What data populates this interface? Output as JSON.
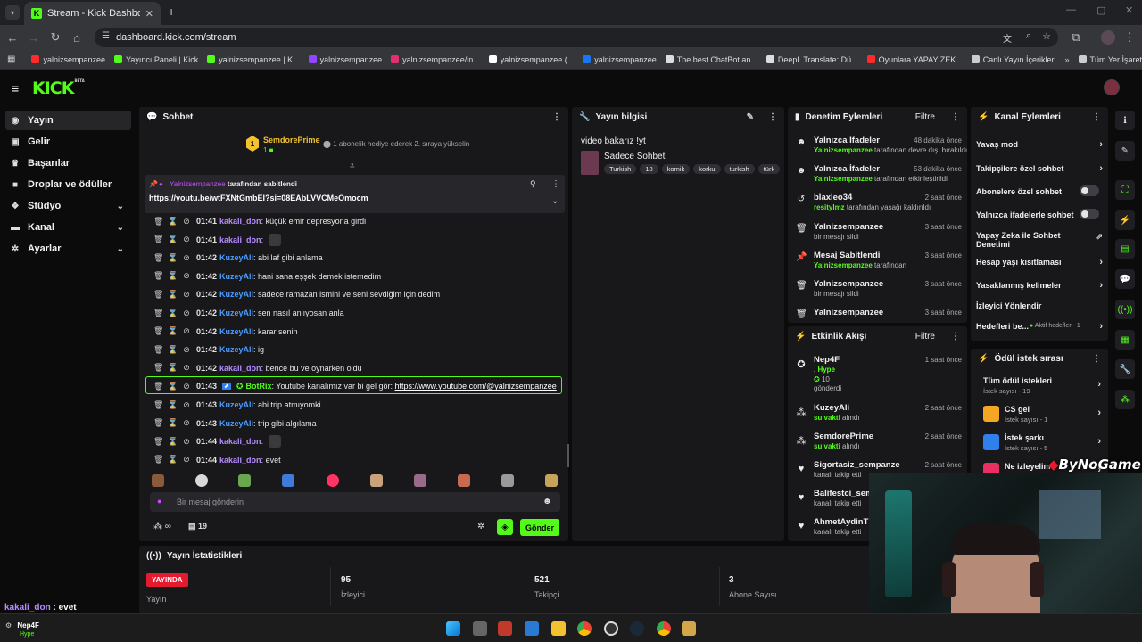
{
  "browser": {
    "tab_title": "Stream - Kick Dashboard",
    "url": "dashboard.kick.com/stream",
    "bookmarks": [
      {
        "label": "yalnizsempanzee",
        "color": "#ff2b2b"
      },
      {
        "label": "Yayıncı Paneli | Kick",
        "color": "#53fc18"
      },
      {
        "label": "yalnizsempanzee | K...",
        "color": "#53fc18"
      },
      {
        "label": "yalnizsempanzee",
        "color": "#9146ff"
      },
      {
        "label": "yalnizsempanzee/in...",
        "color": "#e1306c"
      },
      {
        "label": "yalnizsempanzee (...",
        "color": "#ffffff"
      },
      {
        "label": "yalnizsempanzee",
        "color": "#1877f2"
      },
      {
        "label": "The best ChatBot an...",
        "color": "#dddddd"
      },
      {
        "label": "DeepL Translate: Dü...",
        "color": "#dddddd"
      },
      {
        "label": "Oyunlara YAPAY ZEK...",
        "color": "#ff2b2b"
      },
      {
        "label": "Canlı Yayın İçerikleri",
        "color": "#cccccc"
      }
    ],
    "bookmarks_all": "Tüm Yer İşaretleri"
  },
  "kick": {
    "logo": "KICK",
    "beta": "BETA"
  },
  "sidebar": {
    "items": [
      {
        "label": "Yayın",
        "icon": "broadcast-icon"
      },
      {
        "label": "Gelir",
        "icon": "revenue-icon"
      },
      {
        "label": "Başarılar",
        "icon": "trophy-icon"
      },
      {
        "label": "Droplar ve ödüller",
        "icon": "gift-icon"
      },
      {
        "label": "Stüdyo",
        "icon": "studio-icon"
      },
      {
        "label": "Kanal",
        "icon": "channel-icon"
      },
      {
        "label": "Ayarlar",
        "icon": "gear-icon"
      }
    ]
  },
  "chat": {
    "title": "Sohbet",
    "top_gifter": "SemdorePrime",
    "top_gifter_count": "1",
    "gift_note": "1 abonelik hediye ederek 2. sıraya yükselin",
    "pinned_by_user": "Yalnizsempanzee",
    "pinned_by_suffix": "tarafından sabitlendi",
    "pinned_link": "https://youtu.be/wtFXNtGmbEI?si=08EAbLVVCMeOmocm",
    "messages": [
      {
        "time": "01:41",
        "user": "kakali_don",
        "cls": "u-p",
        "text": ": küçük emir depresyona girdi"
      },
      {
        "time": "01:41",
        "user": "kakali_don",
        "cls": "u-p",
        "text": ":"
      },
      {
        "time": "01:42",
        "user": "KuzeyAli",
        "cls": "u-b",
        "text": ": abi laf gibi anlama"
      },
      {
        "time": "01:42",
        "user": "KuzeyAli",
        "cls": "u-b",
        "text": ": hani sana eşşek demek istemedim"
      },
      {
        "time": "01:42",
        "user": "KuzeyAli",
        "cls": "u-b",
        "text": ": sadece ramazan ismini ve seni sevdiğim için dedim"
      },
      {
        "time": "01:42",
        "user": "KuzeyAli",
        "cls": "u-b",
        "text": ": sen nasıl anlıyosan anla"
      },
      {
        "time": "01:42",
        "user": "KuzeyAli",
        "cls": "u-b",
        "text": ": karar senin"
      },
      {
        "time": "01:42",
        "user": "KuzeyAli",
        "cls": "u-b",
        "text": ": ig"
      },
      {
        "time": "01:42",
        "user": "kakali_don",
        "cls": "u-p",
        "text": ": bence bu ve oynarken oldu"
      },
      {
        "time": "01:43",
        "user": "BotRix",
        "cls": "u-g",
        "text": ": Youtube kanalımız var bi gel gör: ",
        "link": "https://www.youtube.com/@yalnizsempanzee"
      },
      {
        "time": "01:43",
        "user": "KuzeyAli",
        "cls": "u-b",
        "text": ": abi trip atmıyomki"
      },
      {
        "time": "01:43",
        "user": "KuzeyAli",
        "cls": "u-b",
        "text": ": trip gibi algılama"
      },
      {
        "time": "01:44",
        "user": "kakali_don",
        "cls": "u-p",
        "text": ":"
      },
      {
        "time": "01:44",
        "user": "kakali_don",
        "cls": "u-p",
        "text": ": evet"
      }
    ],
    "input_placeholder": "Bir mesaj gönderin",
    "viewer_count": "19",
    "send_label": "Gönder"
  },
  "stream_info": {
    "title": "Yayın bilgisi",
    "stream_title": "video bakarız !yt",
    "category": "Sadece Sohbet",
    "tags": [
      "Turkish",
      "18",
      "komik",
      "korku",
      "turkish",
      "türk"
    ]
  },
  "mod_actions": {
    "title": "Denetim Eylemleri",
    "filter": "Filtre",
    "rows": [
      {
        "icon": "smile-icon",
        "name": "Yalnızca İfadeler",
        "time": "48 dakika önce",
        "actor": "Yalnizsempanzee",
        "rest": " tarafından devre dışı bırakıldı"
      },
      {
        "icon": "smile-icon",
        "name": "Yalnızca İfadeler",
        "time": "53 dakika önce",
        "actor": "Yalnizsempanzee",
        "rest": " tarafından etkinleştirildi"
      },
      {
        "icon": "unban-icon",
        "name": "blaxleo34",
        "time": "2 saat önce",
        "actor": "resitylmz",
        "rest": " tarafından yasağı kaldırıldı"
      },
      {
        "icon": "trash-icon",
        "name": "Yalnizsempanzee",
        "time": "3 saat önce",
        "actor": "",
        "rest": "bir mesajı sildi"
      },
      {
        "icon": "pin-icon",
        "name": "Mesaj Sabitlendi",
        "time": "3 saat önce",
        "actor": "Yalnizsempanzee",
        "rest": " tarafından"
      },
      {
        "icon": "trash-icon",
        "name": "Yalnizsempanzee",
        "time": "3 saat önce",
        "actor": "",
        "rest": "bir mesajı sildi"
      },
      {
        "icon": "trash-icon",
        "name": "Yalnizsempanzee",
        "time": "3 saat önce",
        "actor": "",
        "rest": ""
      }
    ]
  },
  "activity": {
    "title": "Etkinlik Akışı",
    "filter": "Filtre",
    "rows": [
      {
        "icon": "kick-icon",
        "name": "Nep4F",
        "time": "1 saat önce",
        "l1": "Hype",
        "l2": "10",
        "l3": "gönderdi"
      },
      {
        "icon": "follow-icon",
        "name": "KuzeyAli",
        "time": "2 saat önce",
        "l1": "su vakti",
        "l2": " alındı"
      },
      {
        "icon": "follow-icon",
        "name": "SemdorePrime",
        "time": "2 saat önce",
        "l1": "su vakti",
        "l2": " alındı"
      },
      {
        "icon": "heart-icon",
        "name": "Sigortasiz_sempanze",
        "time": "2 saat önce",
        "l1": "",
        "l2": "kanalı takip etti"
      },
      {
        "icon": "heart-icon",
        "name": "Balifestci_semp",
        "time": "",
        "l1": "",
        "l2": "kanalı takip etti"
      },
      {
        "icon": "heart-icon",
        "name": "AhmetAydinTM",
        "time": "",
        "l1": "",
        "l2": "kanalı takip etti"
      }
    ]
  },
  "channel_actions": {
    "title": "Kanal Eylemleri",
    "rows": [
      {
        "label": "Yavaş mod",
        "ctl": "chevron"
      },
      {
        "label": "Takipçilere özel sohbet",
        "ctl": "chevron"
      },
      {
        "label": "Abonelere özel sohbet",
        "ctl": "toggle"
      },
      {
        "label": "Yalnızca ifadelerle sohbet",
        "ctl": "toggle"
      },
      {
        "label": "Yapay Zeka ile Sohbet Denetimi",
        "ctl": "external"
      },
      {
        "label": "Hesap yaşı kısıtlaması",
        "ctl": "chevron"
      },
      {
        "label": "Yasaklanmış kelimeler",
        "ctl": "chevron"
      },
      {
        "label": "İzleyici Yönlendir",
        "ctl": "none"
      },
      {
        "label": "Hedefleri be...",
        "ctl": "chevron",
        "extra": "Aktif hedefler - 1"
      }
    ]
  },
  "reward_queue": {
    "title": "Ödül istek sırası",
    "rows": [
      {
        "label": "Tüm ödül istekleri",
        "sub": "İstek sayısı - 19",
        "color": ""
      },
      {
        "label": "CS gel",
        "sub": "İstek sayısı - 1",
        "color": "#f5a623"
      },
      {
        "label": "İstek şarkı",
        "sub": "İstek sayısı - 5",
        "color": "#2f80ed"
      },
      {
        "label": "Ne izleyelim",
        "sub": "İstek sayısı - 0",
        "color": "#eb2f64"
      }
    ]
  },
  "watermark": "ByNoGame",
  "stats": {
    "title": "Yayın İstatistikleri",
    "live": "YAYINDA",
    "items": [
      {
        "value": "",
        "label": "Yayın"
      },
      {
        "value": "95",
        "label": "İzleyici"
      },
      {
        "value": "521",
        "label": "Takipçi"
      },
      {
        "value": "3",
        "label": "Abone Sayısı"
      }
    ]
  },
  "overlay": {
    "chat_user": "kakali_don",
    "chat_text": " : evet",
    "notif_user": "Nep4F",
    "notif_text": "Hype"
  }
}
